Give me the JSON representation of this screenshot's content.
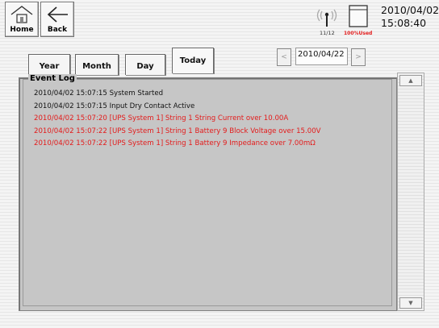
{
  "topbar": {
    "home_label": "Home",
    "back_label": "Back",
    "signal_text": "11/12",
    "storage_text": "100%Used",
    "date": "2010/04/02",
    "time": "15:08:40"
  },
  "tabs": [
    {
      "label": "Year"
    },
    {
      "label": "Month"
    },
    {
      "label": "Day"
    },
    {
      "label": "Today"
    }
  ],
  "date_nav": {
    "prev_glyph": "<",
    "next_glyph": ">",
    "date": "2010/04/22"
  },
  "event_log": {
    "title": "Event Log",
    "entries": [
      {
        "text": "2010/04/02 15:07:15 System Started",
        "color": "#111111"
      },
      {
        "text": "2010/04/02 15:07:15 Input Dry Contact Active",
        "color": "#111111"
      },
      {
        "text": "2010/04/02 15:07:20 [UPS System 1] String 1 String Current over 10.00A",
        "color": "#e31b1b"
      },
      {
        "text": "2010/04/02 15:07:22 [UPS System 1] String 1 Battery 9 Block Voltage over 15.00V",
        "color": "#e31b1b"
      },
      {
        "text": "2010/04/02 15:07:22 [UPS System 1] String 1 Battery 9 Impedance over 7.00mΩ",
        "color": "#e31b1b"
      }
    ]
  },
  "scrollbar": {
    "up_glyph": "▲",
    "down_glyph": "▼"
  },
  "colors": {
    "alarm": "#e31b1b",
    "normal": "#111111",
    "storage": "#e31b1b"
  }
}
